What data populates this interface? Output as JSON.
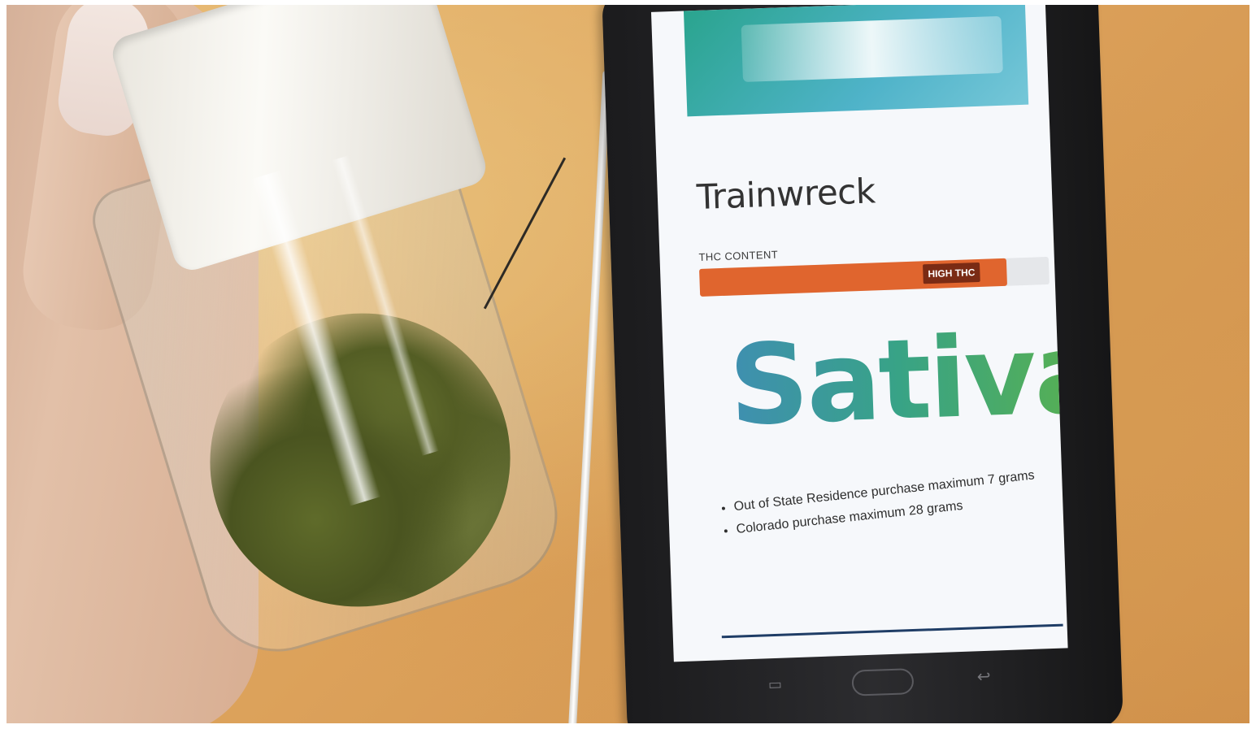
{
  "screen": {
    "strain_name": "Trainwreck",
    "thc_label": "THC CONTENT",
    "thc_badge": "HIGH THC",
    "thc_level": 0.88,
    "strain_type": "Sativa",
    "bullets": [
      "Out of State Residence purchase maximum 7 grams",
      "Colorado purchase maximum 28 grams"
    ]
  },
  "device": {
    "nav_icons": [
      "recent-apps-icon",
      "home-button",
      "back-icon"
    ]
  },
  "colors": {
    "thc_bar": "#e0652e",
    "thc_badge": "#7a2b14",
    "sativa_gradient_start": "#3f8fb1",
    "sativa_gradient_end": "#5cb24a"
  }
}
